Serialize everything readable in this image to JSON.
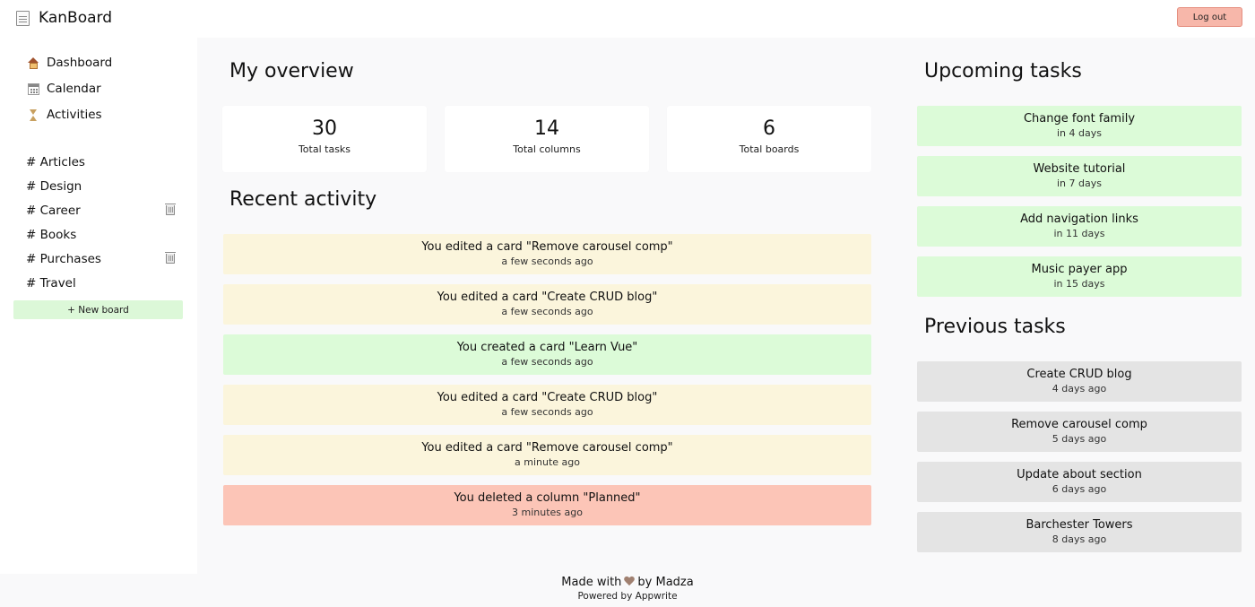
{
  "header": {
    "app_title": "KanBoard",
    "logout_label": "Log out"
  },
  "sidebar": {
    "nav": [
      {
        "label": "Dashboard",
        "icon": "house-icon"
      },
      {
        "label": "Calendar",
        "icon": "calendar-icon"
      },
      {
        "label": "Activities",
        "icon": "hourglass-icon"
      }
    ],
    "boards": [
      {
        "label": "# Articles",
        "deletable": false
      },
      {
        "label": "# Design",
        "deletable": false
      },
      {
        "label": "# Career",
        "deletable": true
      },
      {
        "label": "# Books",
        "deletable": false
      },
      {
        "label": "# Purchases",
        "deletable": true
      },
      {
        "label": "# Travel",
        "deletable": false
      }
    ],
    "new_board_label": "+ New board"
  },
  "overview": {
    "title": "My overview",
    "stats": [
      {
        "value": "30",
        "label": "Total tasks"
      },
      {
        "value": "14",
        "label": "Total columns"
      },
      {
        "value": "6",
        "label": "Total boards"
      }
    ]
  },
  "recent_activity": {
    "title": "Recent activity",
    "items": [
      {
        "text": "You edited a card \"Remove carousel comp\"",
        "time": "a few seconds ago",
        "color": "#fbf5dc"
      },
      {
        "text": "You edited a card \"Create CRUD blog\"",
        "time": "a few seconds ago",
        "color": "#fbf5dc"
      },
      {
        "text": "You created a card \"Learn Vue\"",
        "time": "a few seconds ago",
        "color": "#dcfbd8"
      },
      {
        "text": "You edited a card \"Create CRUD blog\"",
        "time": "a few seconds ago",
        "color": "#fbf5dc"
      },
      {
        "text": "You edited a card \"Remove carousel comp\"",
        "time": "a minute ago",
        "color": "#fbf5dc"
      },
      {
        "text": "You deleted a column \"Planned\"",
        "time": "3 minutes ago",
        "color": "#fcc5b7"
      }
    ]
  },
  "upcoming_tasks": {
    "title": "Upcoming tasks",
    "color": "#dcfbd8",
    "items": [
      {
        "name": "Change font family",
        "due": "in 4 days"
      },
      {
        "name": "Website tutorial",
        "due": "in 7 days"
      },
      {
        "name": "Add navigation links",
        "due": "in 11 days"
      },
      {
        "name": "Music payer app",
        "due": "in 15 days"
      }
    ]
  },
  "previous_tasks": {
    "title": "Previous tasks",
    "color": "#e4e4e4",
    "items": [
      {
        "name": "Create CRUD blog",
        "due": "4 days ago"
      },
      {
        "name": "Remove carousel comp",
        "due": "5 days ago"
      },
      {
        "name": "Update about section",
        "due": "6 days ago"
      },
      {
        "name": "Barchester Towers",
        "due": "8 days ago"
      }
    ]
  },
  "footer": {
    "made_with": "Made with",
    "by": "by Madza",
    "powered_by": "Powered by Appwrite"
  },
  "colors": {
    "logout_bg": "#f7b7aa",
    "new_board_bg": "#dcf8d8",
    "page_bg": "#f9f9fa"
  }
}
